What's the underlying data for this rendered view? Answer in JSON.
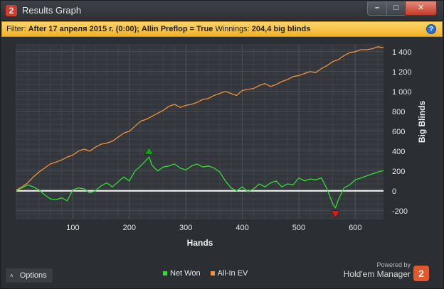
{
  "window": {
    "app_icon": "2",
    "title": "Results Graph",
    "min_glyph": "–",
    "max_glyph": "□",
    "close_glyph": "✕"
  },
  "filter": {
    "label": "Filter:",
    "conditions": "After 17 апреля 2015 г. (0:00); Allin Preflop = True",
    "winnings_label": "Winnings:",
    "winnings_value": "204,4 big blinds",
    "help_glyph": "?"
  },
  "options": {
    "label": "Options",
    "caret": "˄"
  },
  "brand": {
    "powered": "Powered by",
    "name": "Hold'em Manager",
    "badge": "2"
  },
  "colors": {
    "net_won": "#33dd33",
    "all_in_ev": "#f0923a",
    "zero_line": "#ffffff"
  },
  "chart_data": {
    "type": "line",
    "xlabel": "Hands",
    "ylabel": "Big Blinds",
    "xlim": [
      0,
      650
    ],
    "ylim": [
      -280,
      1470
    ],
    "x_ticks": [
      100,
      200,
      300,
      400,
      500,
      600
    ],
    "y_ticks": [
      -200,
      0,
      200,
      400,
      600,
      800,
      1000,
      1200,
      1400
    ],
    "y_tick_labels": [
      "-200",
      "0",
      "200",
      "400",
      "600",
      "800",
      "1 000",
      "1 200",
      "1 400"
    ],
    "x_tick_labels": [
      "100",
      "200",
      "300",
      "400",
      "500",
      "600"
    ],
    "grid": true,
    "legend": "bottom-center",
    "series": [
      {
        "name": "Net Won",
        "x": [
          0,
          10,
          20,
          30,
          40,
          50,
          60,
          70,
          80,
          90,
          100,
          110,
          120,
          130,
          140,
          150,
          160,
          170,
          180,
          190,
          200,
          210,
          220,
          230,
          235,
          240,
          250,
          260,
          270,
          280,
          290,
          300,
          310,
          320,
          330,
          340,
          350,
          360,
          370,
          380,
          390,
          400,
          410,
          420,
          430,
          440,
          450,
          460,
          470,
          480,
          490,
          500,
          510,
          520,
          530,
          540,
          550,
          560,
          565,
          570,
          580,
          590,
          600,
          610,
          620,
          630,
          640,
          650
        ],
        "y": [
          0,
          30,
          60,
          40,
          10,
          -40,
          -80,
          -90,
          -70,
          -100,
          10,
          30,
          20,
          -20,
          0,
          50,
          80,
          40,
          90,
          140,
          100,
          200,
          250,
          310,
          340,
          260,
          200,
          240,
          250,
          270,
          230,
          210,
          250,
          270,
          240,
          250,
          230,
          190,
          100,
          30,
          0,
          40,
          -10,
          20,
          70,
          40,
          80,
          100,
          40,
          70,
          60,
          130,
          100,
          120,
          110,
          130,
          20,
          -130,
          -170,
          -90,
          30,
          60,
          110,
          130,
          150,
          170,
          190,
          204
        ]
      },
      {
        "name": "All-In EV",
        "x": [
          0,
          10,
          20,
          30,
          40,
          50,
          60,
          70,
          80,
          90,
          100,
          110,
          120,
          130,
          140,
          150,
          160,
          170,
          180,
          190,
          200,
          210,
          220,
          230,
          240,
          250,
          260,
          270,
          280,
          290,
          300,
          310,
          320,
          330,
          340,
          350,
          360,
          370,
          380,
          390,
          400,
          410,
          420,
          430,
          440,
          450,
          460,
          470,
          480,
          490,
          500,
          510,
          520,
          530,
          540,
          550,
          560,
          570,
          580,
          590,
          600,
          610,
          620,
          630,
          640,
          650
        ],
        "y": [
          10,
          40,
          80,
          140,
          190,
          230,
          270,
          290,
          310,
          340,
          360,
          400,
          420,
          400,
          440,
          470,
          480,
          500,
          540,
          580,
          600,
          650,
          700,
          720,
          750,
          780,
          810,
          850,
          870,
          840,
          860,
          870,
          890,
          920,
          930,
          960,
          980,
          1000,
          980,
          960,
          1010,
          1020,
          1030,
          1060,
          1080,
          1050,
          1070,
          1100,
          1120,
          1150,
          1160,
          1180,
          1200,
          1190,
          1230,
          1260,
          1300,
          1320,
          1360,
          1390,
          1400,
          1420,
          1420,
          1430,
          1450,
          1440
        ]
      }
    ],
    "markers": [
      {
        "type": "max",
        "series": "Net Won",
        "x": 235,
        "y": 340,
        "color": "#1a9a1a"
      },
      {
        "type": "min",
        "series": "Net Won",
        "x": 565,
        "y": -170,
        "color": "#e01818"
      }
    ]
  }
}
